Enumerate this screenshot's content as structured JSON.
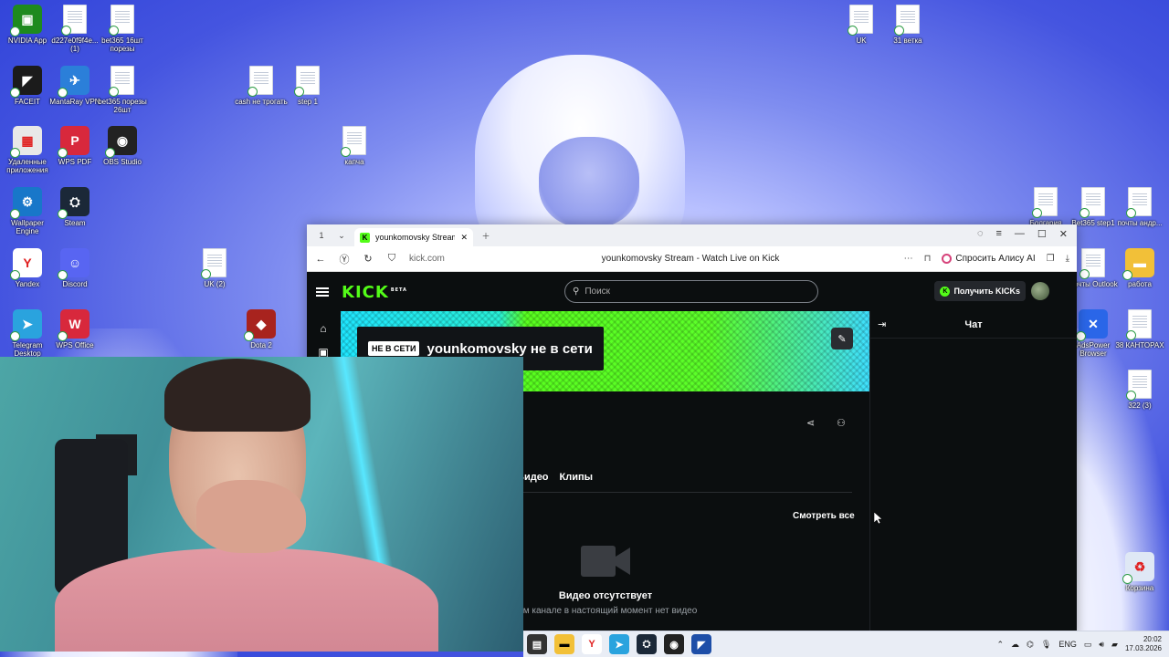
{
  "desktop": {
    "icons": [
      {
        "label": "NVIDIA App",
        "color": "#1e8a1e",
        "glyph": "▣"
      },
      {
        "label": "d227e0f9f4e... (1)",
        "file": true
      },
      {
        "label": "bet365 16шт порезы",
        "file": true
      },
      {
        "label": "FACEIT",
        "color": "#1b1b1b",
        "glyph": "◤"
      },
      {
        "label": "MantaRay VPN",
        "color": "#2b7fd9",
        "glyph": "✈"
      },
      {
        "label": "bet365 порезы 26шт",
        "file": true
      },
      {
        "label": "cash не трогать",
        "file": true
      },
      {
        "label": "step 1",
        "file": true
      },
      {
        "label": "Удаленные приложения",
        "color": "#e8e8e8",
        "glyph": "▦"
      },
      {
        "label": "WPS PDF",
        "color": "#d8283c",
        "glyph": "P"
      },
      {
        "label": "OBS Studio",
        "color": "#222",
        "glyph": "◉"
      },
      {
        "label": "капча",
        "file": true
      },
      {
        "label": "Wallpaper Engine",
        "color": "#1877c9",
        "glyph": "⚙"
      },
      {
        "label": "Steam",
        "color": "#1b2838",
        "glyph": "⛭"
      },
      {
        "label": "Yandex",
        "color": "#ffffff",
        "glyph": "Y"
      },
      {
        "label": "Discord",
        "color": "#5865f2",
        "glyph": "☺"
      },
      {
        "label": "UK (2)",
        "file": true
      },
      {
        "label": "Telegram Desktop",
        "color": "#2aa3de",
        "glyph": "➤"
      },
      {
        "label": "WPS Office",
        "color": "#d8283c",
        "glyph": "W"
      },
      {
        "label": "Dota 2",
        "color": "#a8231e",
        "glyph": "◆"
      },
      {
        "label": "UK",
        "file": true
      },
      {
        "label": "31 ветка",
        "file": true
      },
      {
        "label": "Болгария",
        "file": true
      },
      {
        "label": "Bet365 step1",
        "file": true
      },
      {
        "label": "почты андр...",
        "file": true
      },
      {
        "label": "Почты Outlook",
        "file": true
      },
      {
        "label": "работа",
        "color": "#f2c038",
        "glyph": "▬"
      },
      {
        "label": "AdsPower Browser",
        "color": "#2a66e8",
        "glyph": "✕"
      },
      {
        "label": "38 КАНТОРАХ",
        "file": true
      },
      {
        "label": "322 (3)",
        "file": true
      },
      {
        "label": "Корзина",
        "color": "#dfe8f5",
        "glyph": "♻"
      }
    ]
  },
  "browser": {
    "tab_count": "1",
    "tab_title": "younkomovsky Stream",
    "url_domain": "kick.com",
    "page_title": "younkomovsky Stream - Watch Live on Kick",
    "ask_alice": "Спросить Алису AI"
  },
  "kick": {
    "logo": "KICK",
    "logo_badge": "BETA",
    "search_placeholder": "Поиск",
    "get_kicks": "Получить KICKs",
    "offline_badge": "НЕ В СЕТИ",
    "offline_text": "younkomovsky не в сети",
    "tabs": [
      "Видео",
      "Клипы"
    ],
    "see_all": "Смотреть все",
    "no_video_title": "Видео отсутствует",
    "no_video_sub": "том канале в настоящий момент нет видео",
    "chat_title": "Чат"
  },
  "taskbar": {
    "lang": "ENG",
    "time": "20:02",
    "date": "17.03.2026"
  }
}
